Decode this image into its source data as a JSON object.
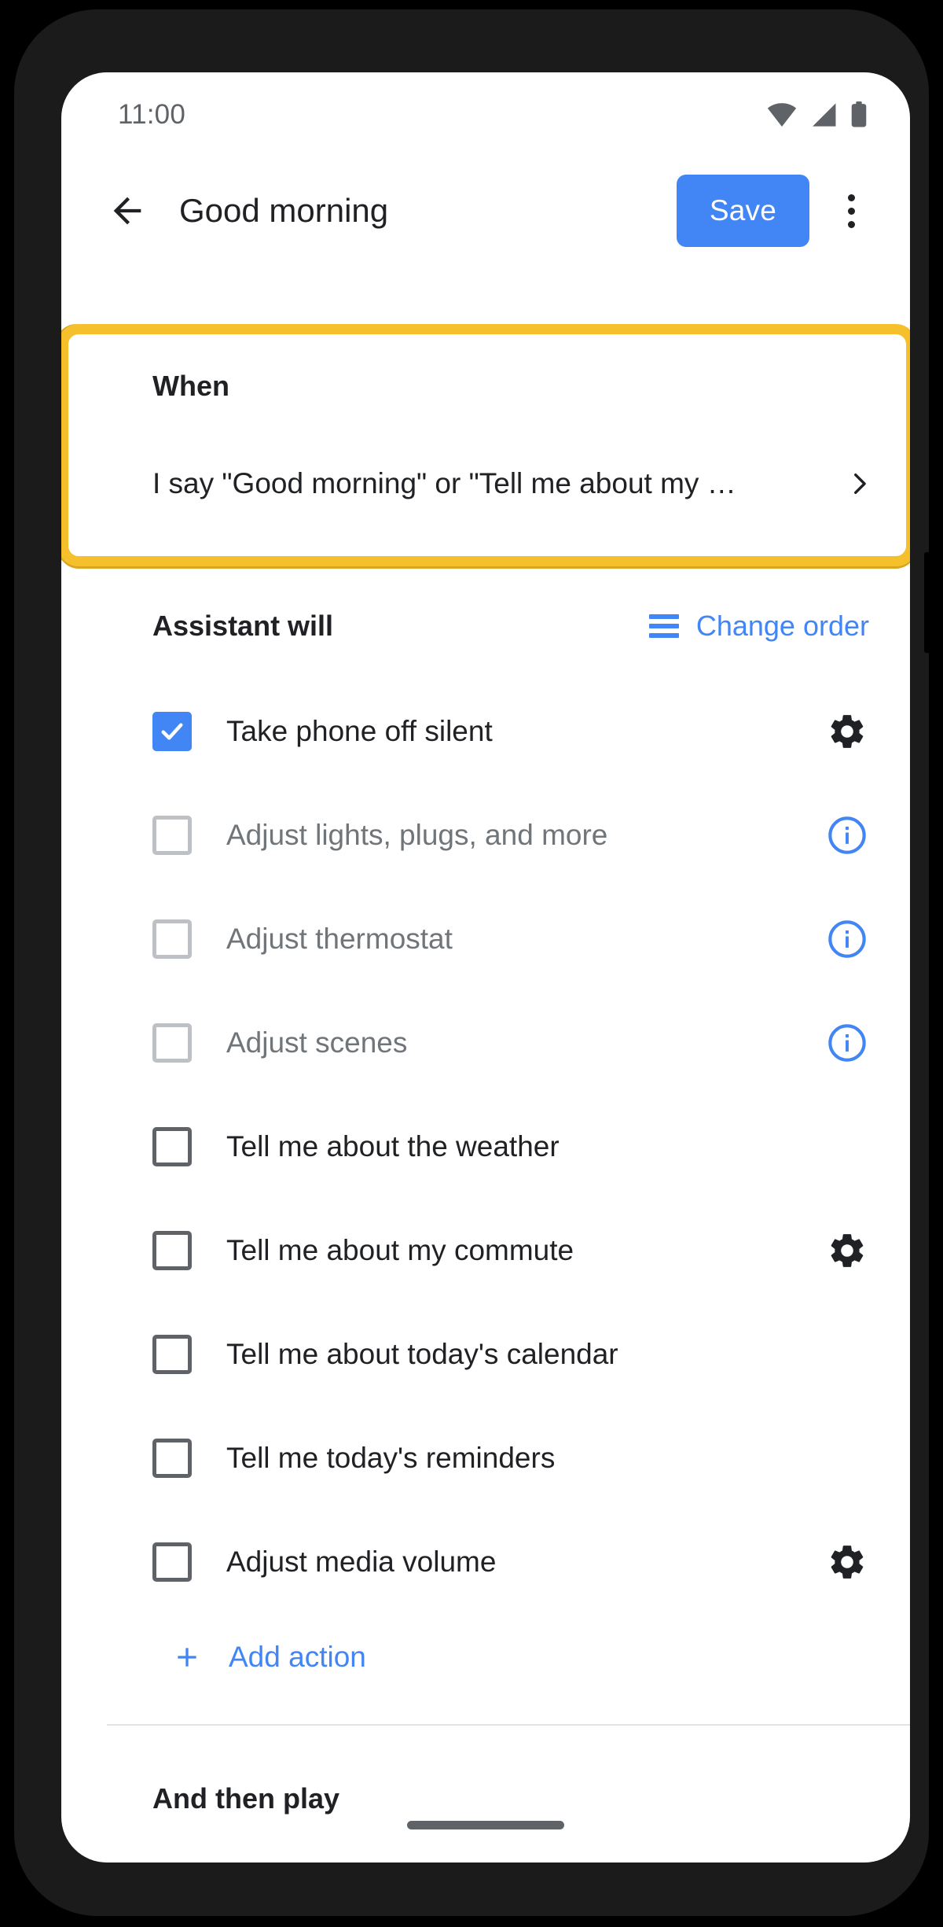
{
  "status_bar": {
    "time": "11:00",
    "icons": [
      "wifi-icon",
      "cellular-signal-icon",
      "battery-icon"
    ]
  },
  "app_bar": {
    "back_icon": "arrow-left-icon",
    "title": "Good morning",
    "save_label": "Save",
    "overflow_icon": "more-vertical-icon"
  },
  "when_section": {
    "label": "When",
    "value": "I say \"Good morning\" or \"Tell me about my …",
    "chevron_icon": "chevron-right-icon",
    "highlight_color": "#f5c02b"
  },
  "assistant_section": {
    "title": "Assistant will",
    "change_order_label": "Change order",
    "reorder_icon": "reorder-lines-icon",
    "actions": [
      {
        "label": "Take phone off silent",
        "checked": true,
        "disabled": false,
        "trailing": "gear-icon"
      },
      {
        "label": "Adjust lights, plugs, and more",
        "checked": false,
        "disabled": true,
        "trailing": "info-icon"
      },
      {
        "label": "Adjust thermostat",
        "checked": false,
        "disabled": true,
        "trailing": "info-icon"
      },
      {
        "label": "Adjust scenes",
        "checked": false,
        "disabled": true,
        "trailing": "info-icon"
      },
      {
        "label": "Tell me about the weather",
        "checked": false,
        "disabled": false,
        "trailing": null
      },
      {
        "label": "Tell me about my commute",
        "checked": false,
        "disabled": false,
        "trailing": "gear-icon"
      },
      {
        "label": "Tell me about today's calendar",
        "checked": false,
        "disabled": false,
        "trailing": null
      },
      {
        "label": "Tell me today's reminders",
        "checked": false,
        "disabled": false,
        "trailing": null
      },
      {
        "label": "Adjust media volume",
        "checked": false,
        "disabled": false,
        "trailing": "gear-icon"
      }
    ],
    "add_action_label": "Add action",
    "add_action_icon": "plus-icon"
  },
  "play_section": {
    "title": "And then play"
  },
  "colors": {
    "accent_blue": "#4285f4",
    "highlight_yellow": "#f5c02b",
    "text_primary": "#202124",
    "text_disabled": "#70757a"
  }
}
